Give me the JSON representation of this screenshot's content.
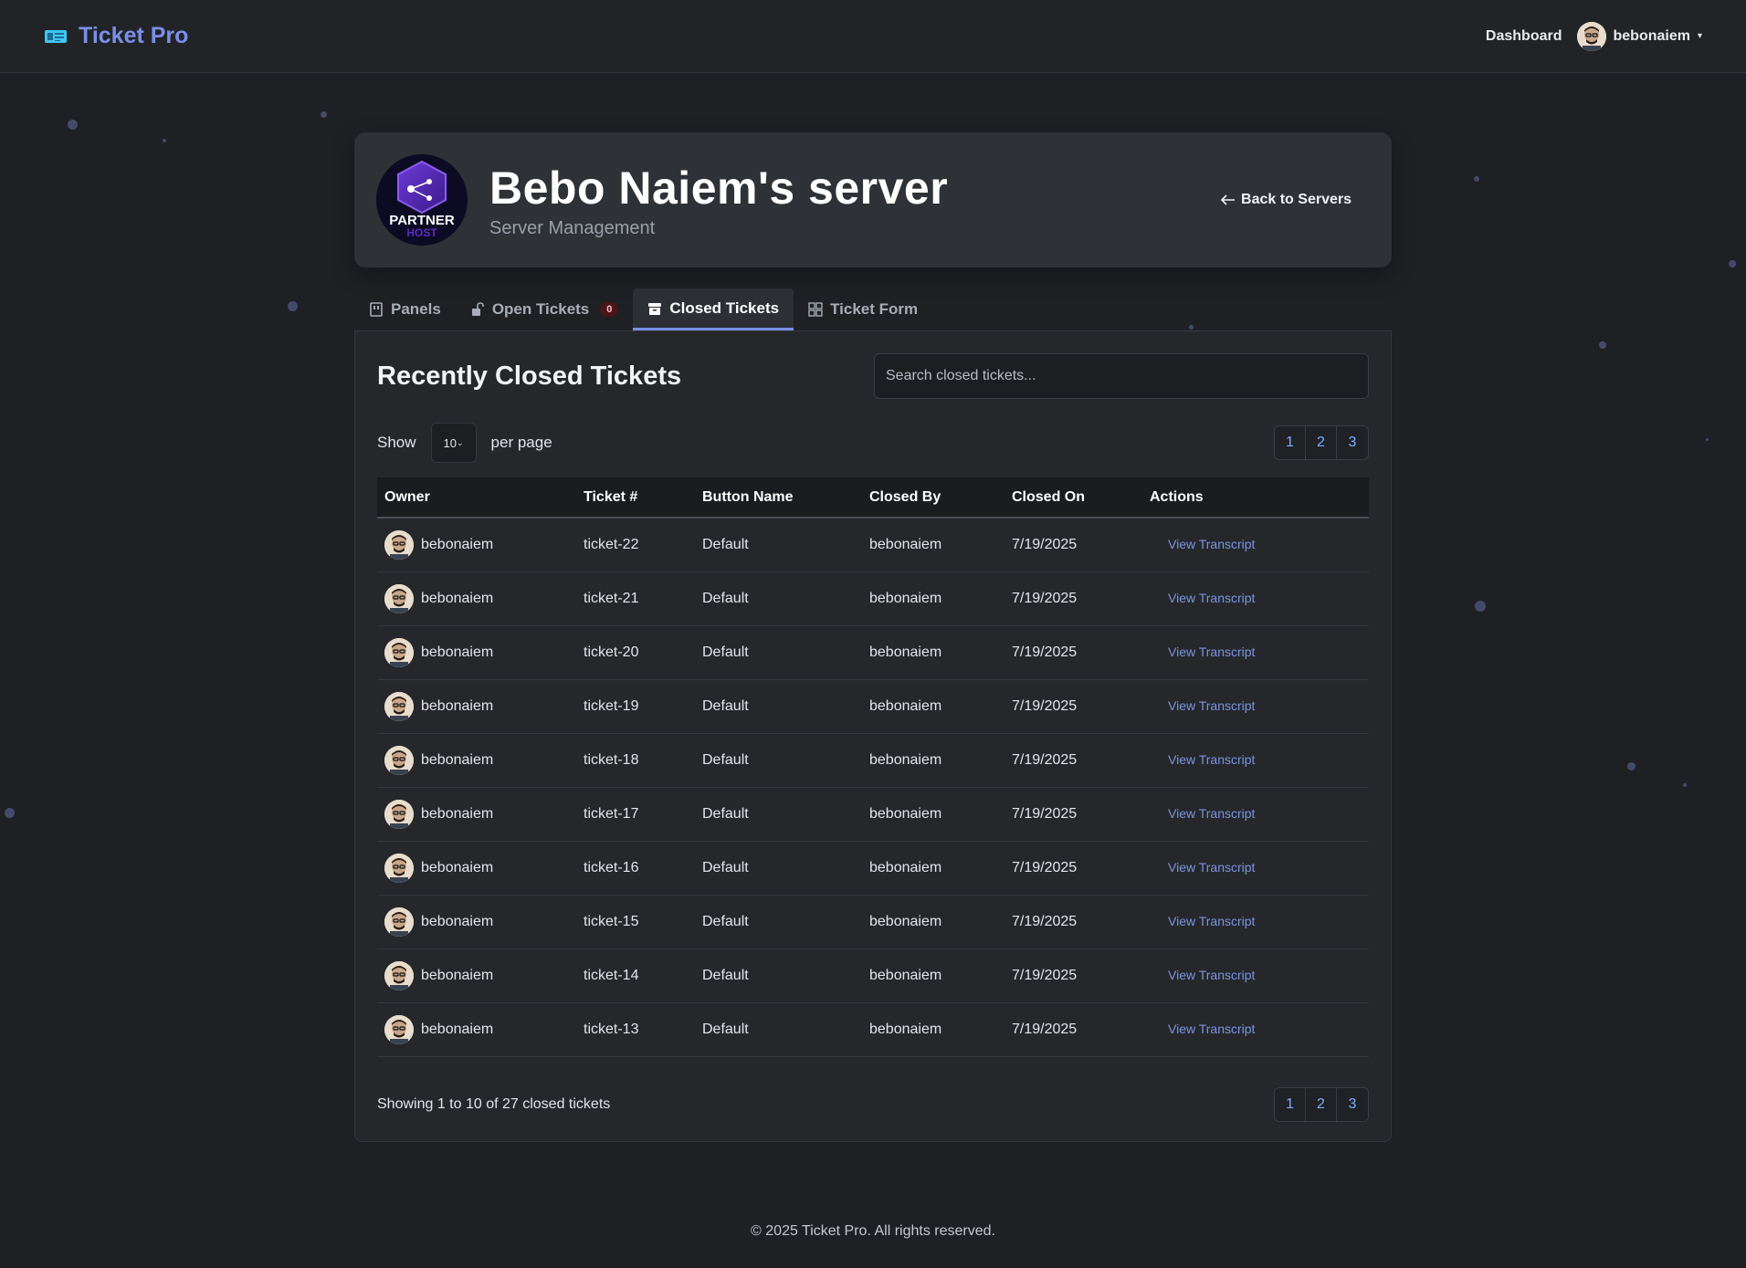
{
  "brand": {
    "name": "Ticket Pro"
  },
  "nav": {
    "dashboard": "Dashboard",
    "user": "bebonaiem"
  },
  "server": {
    "title": "Bebo Naiem's server",
    "subtitle": "Server Management",
    "back_label": "Back to Servers",
    "logo_text": "PARTNER",
    "logo_subtext": "HOST"
  },
  "tabs": [
    {
      "label": "Panels"
    },
    {
      "label": "Open Tickets",
      "badge": "0"
    },
    {
      "label": "Closed Tickets"
    },
    {
      "label": "Ticket Form"
    }
  ],
  "panel": {
    "title": "Recently Closed Tickets",
    "search_placeholder": "Search closed tickets...",
    "show_label": "Show",
    "per_page_value": "10",
    "per_page_label": "per page",
    "pages": [
      "1",
      "2",
      "3"
    ],
    "summary": "Showing 1 to 10 of 27 closed tickets"
  },
  "table": {
    "headers": [
      "Owner",
      "Ticket #",
      "Button Name",
      "Closed By",
      "Closed On",
      "Actions"
    ],
    "action_label": "View Transcript",
    "rows": [
      {
        "owner": "bebonaiem",
        "ticket": "ticket-22",
        "button": "Default",
        "closed_by": "bebonaiem",
        "closed_on": "7/19/2025"
      },
      {
        "owner": "bebonaiem",
        "ticket": "ticket-21",
        "button": "Default",
        "closed_by": "bebonaiem",
        "closed_on": "7/19/2025"
      },
      {
        "owner": "bebonaiem",
        "ticket": "ticket-20",
        "button": "Default",
        "closed_by": "bebonaiem",
        "closed_on": "7/19/2025"
      },
      {
        "owner": "bebonaiem",
        "ticket": "ticket-19",
        "button": "Default",
        "closed_by": "bebonaiem",
        "closed_on": "7/19/2025"
      },
      {
        "owner": "bebonaiem",
        "ticket": "ticket-18",
        "button": "Default",
        "closed_by": "bebonaiem",
        "closed_on": "7/19/2025"
      },
      {
        "owner": "bebonaiem",
        "ticket": "ticket-17",
        "button": "Default",
        "closed_by": "bebonaiem",
        "closed_on": "7/19/2025"
      },
      {
        "owner": "bebonaiem",
        "ticket": "ticket-16",
        "button": "Default",
        "closed_by": "bebonaiem",
        "closed_on": "7/19/2025"
      },
      {
        "owner": "bebonaiem",
        "ticket": "ticket-15",
        "button": "Default",
        "closed_by": "bebonaiem",
        "closed_on": "7/19/2025"
      },
      {
        "owner": "bebonaiem",
        "ticket": "ticket-14",
        "button": "Default",
        "closed_by": "bebonaiem",
        "closed_on": "7/19/2025"
      },
      {
        "owner": "bebonaiem",
        "ticket": "ticket-13",
        "button": "Default",
        "closed_by": "bebonaiem",
        "closed_on": "7/19/2025"
      }
    ]
  },
  "footer": {
    "text": "© 2025 Ticket Pro. All rights reserved."
  },
  "colors": {
    "accent": "#7a8fe8",
    "link": "#7a95e0",
    "page_link": "#7ab0ff",
    "background": "#1e2024"
  }
}
